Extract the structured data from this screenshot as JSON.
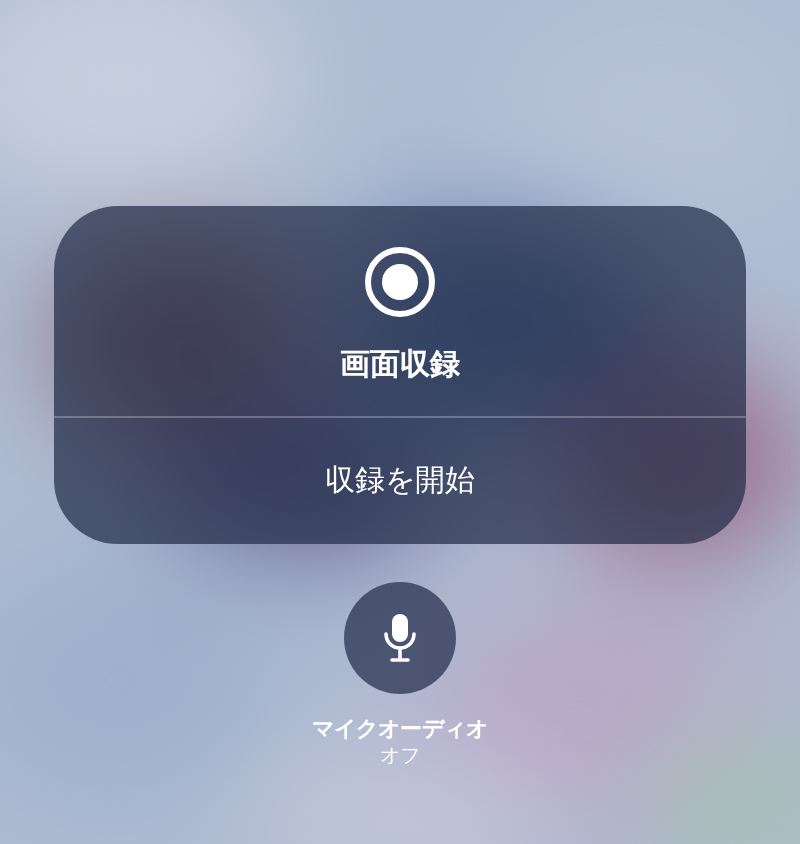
{
  "panel": {
    "title": "画面収録",
    "action": "収録を開始"
  },
  "microphone": {
    "label": "マイクオーディオ",
    "status": "オフ",
    "on": false
  }
}
